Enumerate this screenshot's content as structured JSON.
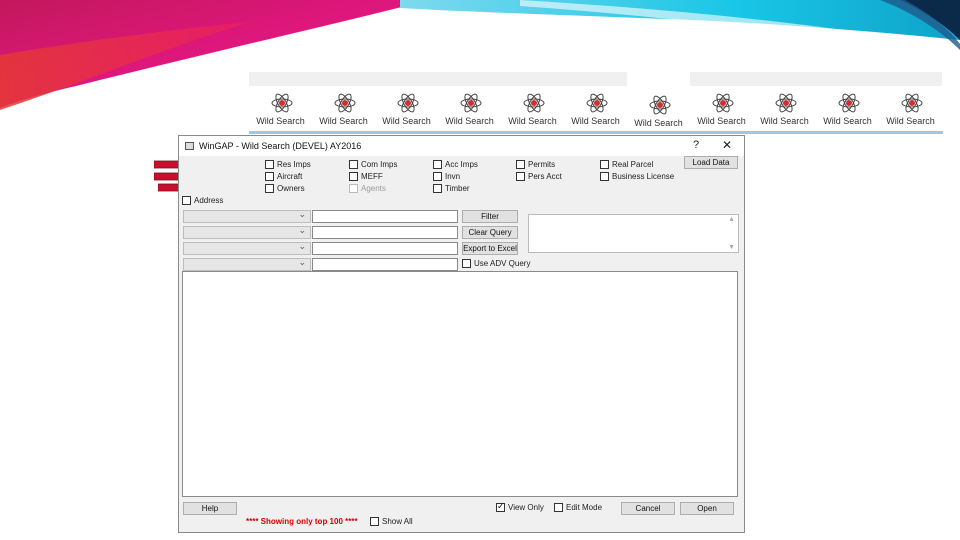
{
  "tabs": [
    {
      "label": "Wild Search",
      "active": false
    },
    {
      "label": "Wild Search",
      "active": false
    },
    {
      "label": "Wild Search",
      "active": false
    },
    {
      "label": "Wild Search",
      "active": false
    },
    {
      "label": "Wild Search",
      "active": false
    },
    {
      "label": "Wild Search",
      "active": false
    },
    {
      "label": "Wild Search",
      "active": true
    },
    {
      "label": "Wild Search",
      "active": false
    },
    {
      "label": "Wild Search",
      "active": false
    },
    {
      "label": "Wild Search",
      "active": false
    },
    {
      "label": "Wild Search",
      "active": false
    }
  ],
  "dialog": {
    "title": "WinGAP - Wild Search (DEVEL) AY2016",
    "help_glyph": "?",
    "close_glyph": "✕",
    "checkboxes": {
      "res_imps": "Res Imps",
      "aircraft": "Aircraft",
      "owners": "Owners",
      "com_imps": "Com Imps",
      "meff": "MEFF",
      "agents": "Agents",
      "acc_imps": "Acc Imps",
      "invn": "Invn",
      "timber": "Timber",
      "permits": "Permits",
      "pers_acct": "Pers Acct",
      "real_parcel": "Real Parcel",
      "business_license": "Business License",
      "address": "Address",
      "use_adv_query": "Use ADV Query",
      "view_only": "View Only",
      "edit_mode": "Edit Mode",
      "show_all": "Show All"
    },
    "buttons": {
      "load_data": "Load Data",
      "filter": "Filter",
      "clear_query": "Clear Query",
      "export_to_excel": "Export to Excel",
      "help": "Help",
      "cancel": "Cancel",
      "open": "Open"
    },
    "status_text": "**** Showing only top  100 ****",
    "view_only_checked": true
  },
  "colors": {
    "arrow": "#c8102e",
    "status": "#d40000",
    "swoosh_magenta": "#e0177e",
    "swoosh_cyan": "#19c6e6",
    "swoosh_navy": "#0b2a4a"
  },
  "icons": {
    "tab": "atom-icon",
    "arrow": "red-arrow-icon"
  }
}
